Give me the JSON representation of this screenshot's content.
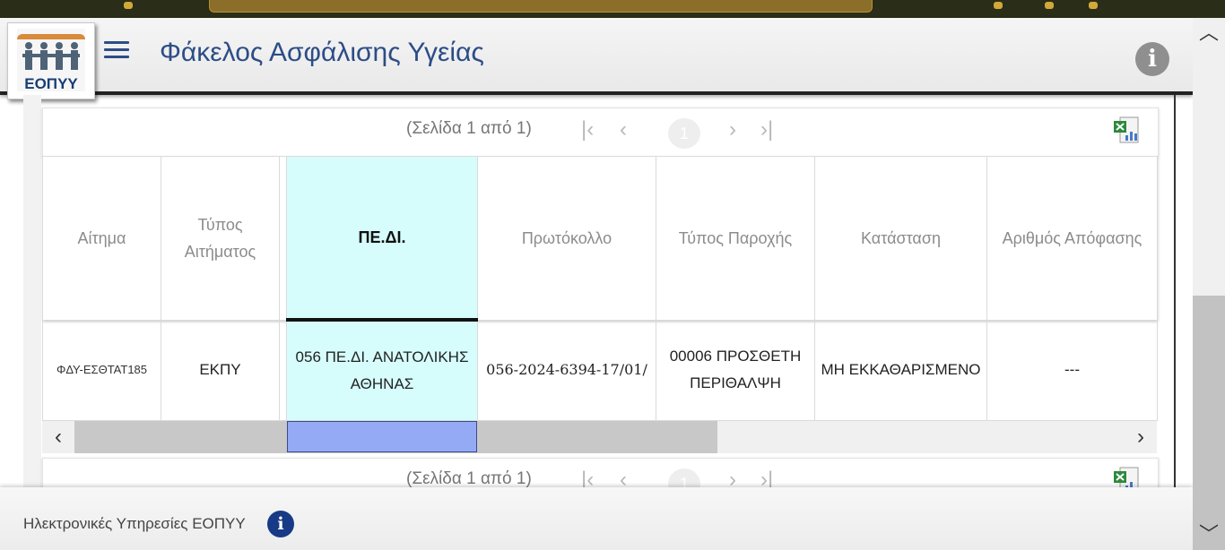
{
  "header": {
    "logo_text": "ΕΟΠΥΥ",
    "title": "Φάκελος Ασφάλισης Υγείας",
    "menu_icon": "hamburger-icon",
    "info_icon": "info-icon",
    "info_glyph": "i"
  },
  "pager": {
    "page_info": "(Σελίδα 1 από 1)",
    "current_page": "1",
    "first_glyph": "|‹",
    "prev_glyph": "‹",
    "next_glyph": "›",
    "last_glyph": "›|",
    "export_icon": "excel-icon"
  },
  "table": {
    "columns": [
      "Αίτημα",
      "Τύπος Αιτήματος",
      "ΠΕ.ΔΙ.",
      "Πρωτόκολλο",
      "Τύπος Παροχής",
      "Κατάσταση",
      "Αριθμός Απόφασης"
    ],
    "selected_column": "ΠΕ.ΔΙ.",
    "rows": [
      {
        "request": "ΦΔΥ-ΕΣΘΤΑΤ185",
        "request_type": "ΕΚΠΥ",
        "pedi": "056 ΠΕ.ΔΙ. ΑΝΑΤΟΛΙΚΗΣ ΑΘΗΝΑΣ",
        "protocol": "056-2024-6394-17/01/",
        "benefit_type": "00006 ΠΡΟΣΘΕΤΗ ΠΕΡΙΘΑΛΨΗ",
        "status": "ΜΗ ΕΚΚΑΘΑΡΙΣΜΕΝΟ",
        "decision_number": "---"
      }
    ]
  },
  "footer": {
    "text": "Ηλεκτρονικές Υπηρεσίες ΕΟΠΥΥ",
    "info_glyph": "i"
  },
  "colors": {
    "brand_blue": "#2c4d86",
    "selected_column_bg": "#d6fdfc",
    "selected_scroll": "#95aaf5",
    "footer_info": "#173a86"
  }
}
